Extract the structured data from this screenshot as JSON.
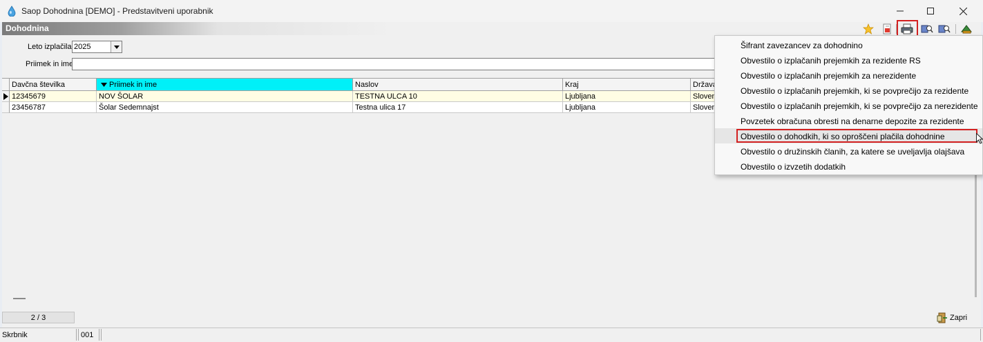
{
  "window": {
    "title": "Saop Dohodnina [DEMO] - Predstavitveni uporabnik",
    "minimize_icon": "minimize-icon",
    "maximize_icon": "maximize-icon",
    "close_icon": "close-icon"
  },
  "module": {
    "title": "Dohodnina",
    "toolbar_icons": [
      "star-icon",
      "export-icon",
      "printer-icon",
      "search-person-icon",
      "search-person-alt-icon",
      "exit-icon"
    ]
  },
  "filters": {
    "year_label": "Leto izplačila",
    "year_value": "2025",
    "name_label": "Priimek in ime",
    "name_value": ""
  },
  "grid": {
    "columns": [
      "Davčna številka",
      "Priimek in ime",
      "Naslov",
      "Kraj",
      "Država"
    ],
    "sorted_column": "Priimek in ime",
    "rows": [
      {
        "tax_number": "12345679",
        "name": "NOV ŠOLAR",
        "address": "TESTNA ULCA 10",
        "city": "Ljubljana",
        "country": "Sloven"
      },
      {
        "tax_number": "23456787",
        "name": "Šolar Sedemnajst",
        "address": "Testna ulica 17",
        "city": "Ljubljana",
        "country": "Sloven"
      }
    ]
  },
  "counter": "2 / 3",
  "close_button_label": "Zapri",
  "status_bar": {
    "user": "Skrbnik",
    "code": "001"
  },
  "print_menu": {
    "items": [
      "Šifrant zavezancev za dohodnino",
      "Obvestilo o izplačanih prejemkih za rezidente RS",
      "Obvestilo o izplačanih prejemkih za nerezidente",
      "Obvestilo o izplačanih prejemkih, ki se povprečijo za rezidente",
      "Obvestilo o izplačanih prejemkih, ki se povprečijo za nerezidente",
      "Povzetek obračuna obresti na denarne depozite za rezidente",
      "Obvestilo o dohodkih, ki so oproščeni plačila dohodnine",
      "Obvestilo o družinskih članih, za katere se uveljavlja olajšava",
      "Obvestilo o izvzetih dodatkih"
    ],
    "highlighted_index": 6
  },
  "colors": {
    "sorted_header": "#00f0f8",
    "selected_row": "#fffde4",
    "highlight_outline": "#d32020"
  }
}
